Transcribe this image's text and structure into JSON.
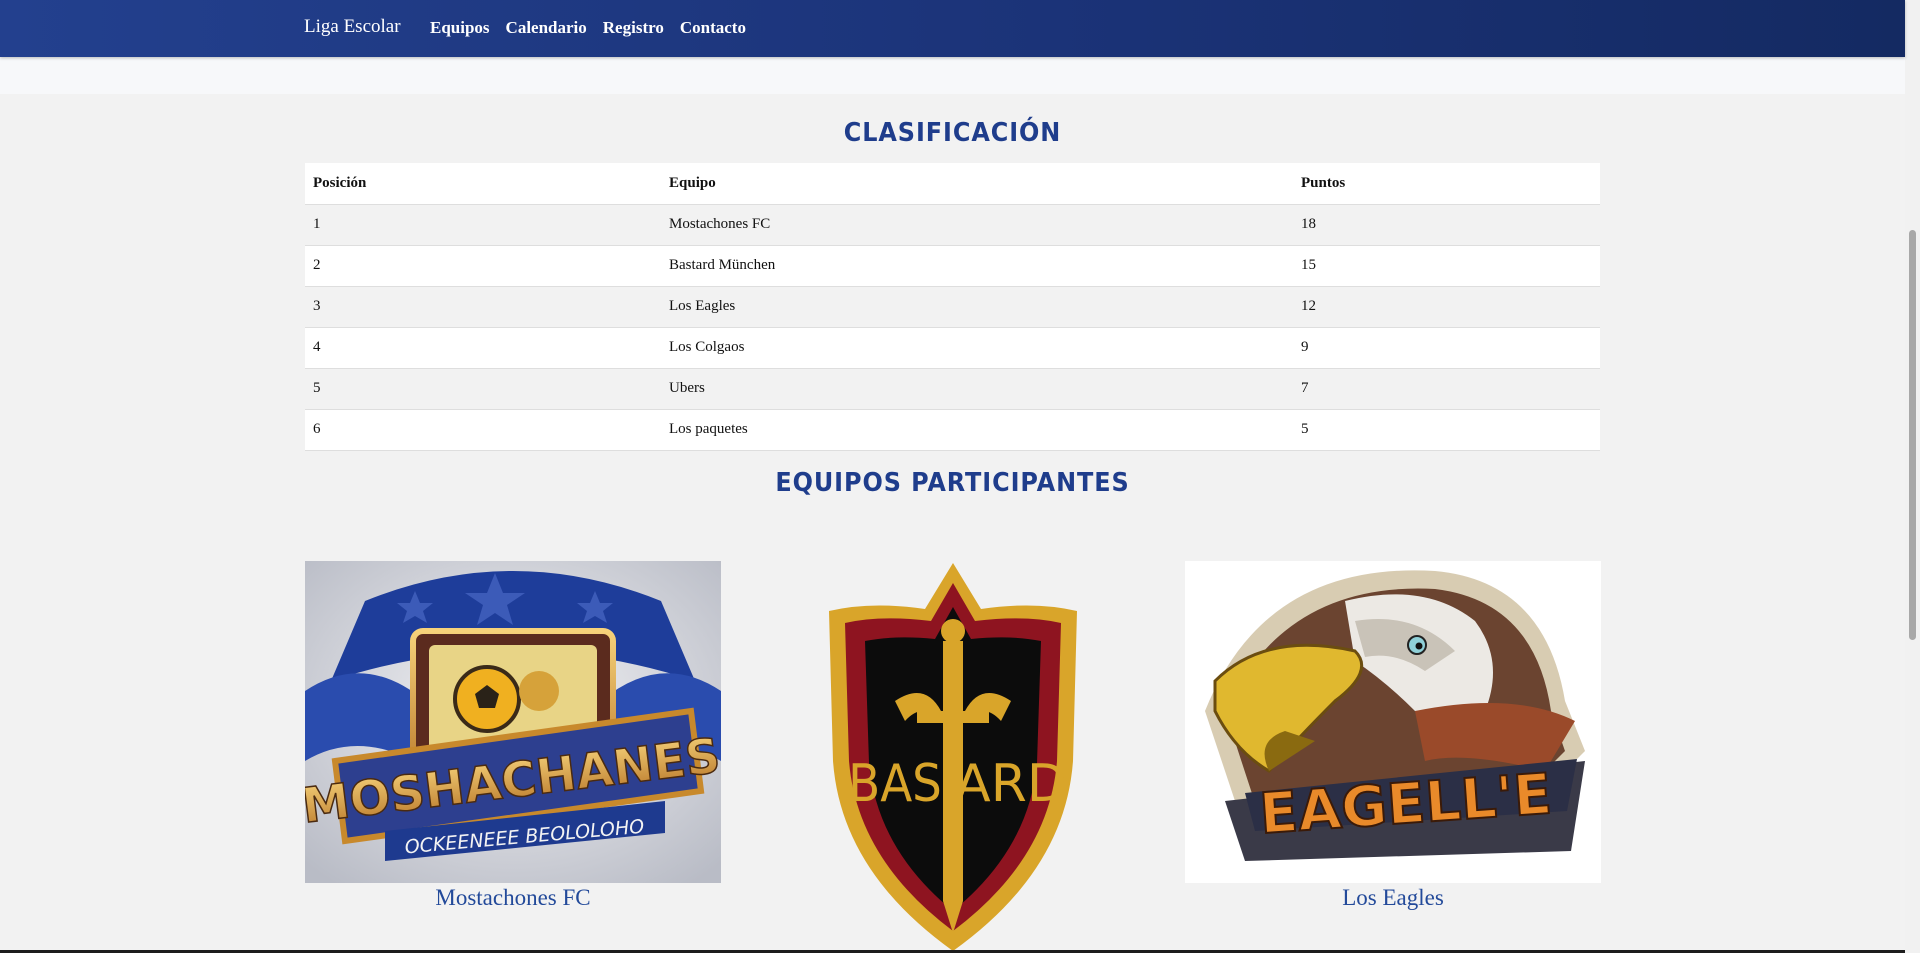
{
  "nav": {
    "brand": "Liga Escolar",
    "links": [
      "Equipos",
      "Calendario",
      "Registro",
      "Contacto"
    ]
  },
  "standings": {
    "title": "CLASIFICACIÓN",
    "headers": [
      "Posición",
      "Equipo",
      "Puntos"
    ],
    "rows": [
      [
        "1",
        "Mostachones FC",
        "18"
      ],
      [
        "2",
        "Bastard München",
        "15"
      ],
      [
        "3",
        "Los Eagles",
        "12"
      ],
      [
        "4",
        "Los Colgaos",
        "9"
      ],
      [
        "5",
        "Ubers",
        "7"
      ],
      [
        "6",
        "Los paquetes",
        "5"
      ]
    ]
  },
  "teams": {
    "title": "EQUIPOS PARTICIPANTES",
    "cards": [
      {
        "name": "Mostachones FC",
        "logo_text": "MOSHACHANES",
        "logo_subtext": "OCKEENEEE BEOLOLOHO"
      },
      {
        "name": "",
        "logo_text_left": "BAS",
        "logo_text_right": "ARD"
      },
      {
        "name": "Los Eagles",
        "logo_text": "EAGELL'E"
      }
    ]
  },
  "colors": {
    "nav": "#1f3a85",
    "title": "#1f3d8c",
    "link": "#234a9a"
  }
}
